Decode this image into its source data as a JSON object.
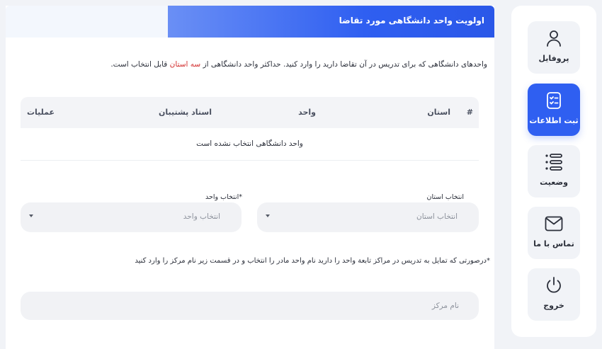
{
  "header": {
    "title": "اولویت واحد دانشگاهی مورد تقاضا"
  },
  "intro": {
    "before": "واحدهای دانشگاهی که برای تدریس در آن تقاضا دارید را وارد کنید. حداکثر واحد دانشگاهی از ",
    "highlight": "سه استان",
    "after": " قابل انتخاب است."
  },
  "table": {
    "columns": [
      "#",
      "استان",
      "واحد",
      "استاد پشتیبان",
      "عملیات"
    ],
    "empty_text": "واحد دانشگاهی انتخاب نشده است"
  },
  "form": {
    "province_label": "انتخاب استان",
    "province_value": "انتخاب استان",
    "unit_label": "*انتخاب واحد",
    "unit_value": "انتخاب واحد",
    "note": "*درصورتی که تمایل به تدریس در مراکز تابعة واحد را دارید نام واحد مادر را انتخاب و در قسمت زیر نام مرکز را وارد کنید",
    "center_placeholder": "نام مرکز"
  },
  "sidebar": {
    "items": [
      {
        "label": "پروفایل",
        "icon": "user-icon",
        "active": false
      },
      {
        "label": "ثبت اطلاعات",
        "icon": "clipboard-list-icon",
        "active": true
      },
      {
        "label": "وضعیت",
        "icon": "list-icon",
        "active": false
      },
      {
        "label": "تماس با ما",
        "icon": "mail-icon",
        "active": false
      },
      {
        "label": "خروج",
        "icon": "power-icon",
        "active": false
      }
    ]
  },
  "colors": {
    "accent": "#2f5ff1",
    "highlight": "#d32f2f",
    "field_bg": "#f1f2f5"
  }
}
